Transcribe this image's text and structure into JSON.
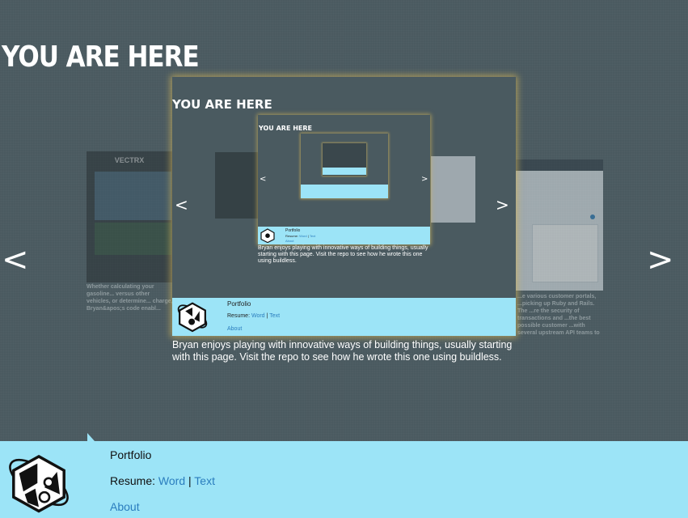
{
  "page": {
    "title": "YOU ARE HERE"
  },
  "nav": {
    "prev": "<",
    "next": ">"
  },
  "slides": {
    "left": {
      "logo_text": "VECTRX",
      "caption": "Whether calculating your gasoline... versus other vehicles, or determine... charge, Bryan&apos;s code enabl..."
    },
    "right": {
      "caption": "...e various customer portals, ...picking up Ruby and Rails. The ...re the security of transactions and ...the best possible customer ...with several upstream API teams to"
    },
    "current": {
      "title": "YOU ARE HERE",
      "portfolio": "Portfolio",
      "resume_label": "Resume:",
      "word": "Word",
      "separator": "|",
      "text": "Text",
      "about": "About",
      "description": "Bryan enjoys playing with innovative ways of building things, usually starting with this page. Visit the repo to see how he wrote this one using buildless."
    }
  },
  "footer": {
    "portfolio": "Portfolio",
    "resume_label": "Resume:",
    "word": "Word",
    "separator": "|",
    "text": "Text",
    "about": "About"
  },
  "colors": {
    "background": "#4a5a60",
    "footer": "#9ce4f7",
    "link": "#2a7dbe",
    "glow": "#d2b45a"
  }
}
